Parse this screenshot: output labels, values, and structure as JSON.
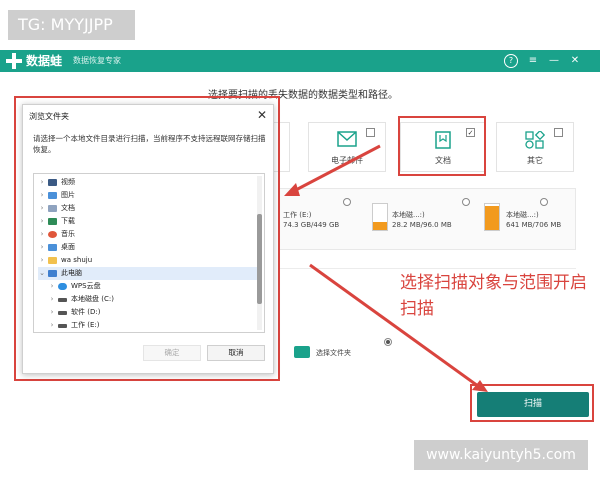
{
  "watermark_top": "TG: MYYJJPP",
  "watermark_bottom": "www.kaiyuntyh5.com",
  "app": {
    "name": "数据蛙",
    "subtitle": "数据恢复专家",
    "instruction": "选择要扫描的丢失数据的数据类型和路径。"
  },
  "titlebar_controls": {
    "help": "?",
    "menu": "≡",
    "minimize": "—",
    "close": "✕"
  },
  "categories": [
    {
      "label": "电子邮件",
      "checked": false,
      "icon": "mail-icon"
    },
    {
      "label": "文档",
      "checked": true,
      "icon": "document-icon"
    },
    {
      "label": "其它",
      "checked": false,
      "icon": "other-icon"
    }
  ],
  "drives": [
    {
      "name": "工作 (E:)",
      "size": "74.3 GB/449 GB",
      "fill_pct": 17
    },
    {
      "name": "本地磁...:)",
      "size": "28.2 MB/96.0 MB",
      "fill_pct": 29
    },
    {
      "name": "本地磁...:)",
      "size": "641 MB/706 MB",
      "fill_pct": 91
    }
  ],
  "folder_option": {
    "label": "选择文件夹",
    "selected": true
  },
  "scan_button": "扫描",
  "annotation": "选择扫描对象与范围开启扫描",
  "colors": {
    "brand": "#1aa28b",
    "scan_button": "#157e76",
    "annotation": "#d9443e",
    "drive_fill": "#f29a1e"
  },
  "dialog": {
    "title": "浏览文件夹",
    "close": "✕",
    "description": "请选择一个本地文件目录进行扫描，当前程序不支持远程联网存储扫描恢复。",
    "ok": "确定",
    "cancel": "取消",
    "tree": [
      {
        "label": "视频",
        "expanded": false,
        "selected": false,
        "icon": "video-icon"
      },
      {
        "label": "图片",
        "expanded": false,
        "selected": false,
        "icon": "picture-icon"
      },
      {
        "label": "文档",
        "expanded": false,
        "selected": false,
        "icon": "document-icon"
      },
      {
        "label": "下载",
        "expanded": false,
        "selected": false,
        "icon": "download-icon"
      },
      {
        "label": "音乐",
        "expanded": false,
        "selected": false,
        "icon": "music-icon"
      },
      {
        "label": "桌面",
        "expanded": false,
        "selected": false,
        "icon": "desktop-icon"
      },
      {
        "label": "wa shuju",
        "expanded": false,
        "selected": false,
        "icon": "folder-icon"
      },
      {
        "label": "此电脑",
        "expanded": true,
        "selected": true,
        "icon": "pc-icon"
      },
      {
        "label": "WPS云盘",
        "expanded": false,
        "selected": false,
        "icon": "cloud-icon"
      },
      {
        "label": "本地磁盘 (C:)",
        "expanded": false,
        "selected": false,
        "icon": "disk-icon"
      },
      {
        "label": "软件 (D:)",
        "expanded": false,
        "selected": false,
        "icon": "disk-icon"
      },
      {
        "label": "工作 (E:)",
        "expanded": false,
        "selected": false,
        "icon": "disk-icon"
      }
    ]
  }
}
